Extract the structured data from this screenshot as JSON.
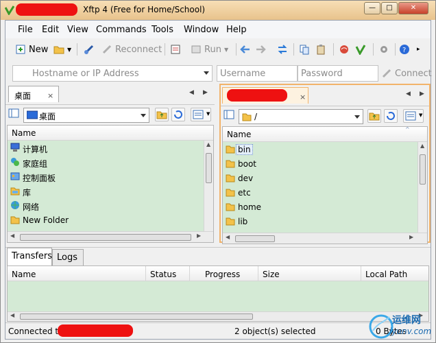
{
  "window": {
    "title": "Xftp 4 (Free for Home/School)",
    "controls": {
      "minimize": "—",
      "maximize": "□",
      "close": "✕"
    }
  },
  "menu": [
    "File",
    "Edit",
    "View",
    "Commands",
    "Tools",
    "Window",
    "Help"
  ],
  "toolbar": {
    "new_label": "New",
    "reconnect_label": "Reconnect",
    "run_label": "Run"
  },
  "connect_bar": {
    "host_placeholder": "Hostname or IP Address",
    "user_placeholder": "Username",
    "pass_placeholder": "Password",
    "connect_label": "Connect"
  },
  "local_panel": {
    "tab_label": "桌面",
    "path": "桌面",
    "column": "Name",
    "items": [
      {
        "label": "计算机",
        "icon": "computer-icon"
      },
      {
        "label": "家庭组",
        "icon": "homegroup-icon"
      },
      {
        "label": "控制面板",
        "icon": "control-panel-icon"
      },
      {
        "label": "库",
        "icon": "library-icon"
      },
      {
        "label": "网络",
        "icon": "network-icon"
      },
      {
        "label": "New Folder",
        "icon": "folder-icon"
      }
    ]
  },
  "remote_panel": {
    "tab_close": "×",
    "path": "/",
    "column": "Name",
    "items": [
      {
        "label": "bin",
        "icon": "folder-icon",
        "selected": true
      },
      {
        "label": "boot",
        "icon": "folder-icon"
      },
      {
        "label": "dev",
        "icon": "folder-icon"
      },
      {
        "label": "etc",
        "icon": "folder-icon"
      },
      {
        "label": "home",
        "icon": "folder-icon"
      },
      {
        "label": "lib",
        "icon": "folder-icon"
      }
    ]
  },
  "bottom_tabs": [
    "Transfers",
    "Logs"
  ],
  "transfer_columns": [
    "Name",
    "Status",
    "Progress",
    "Size",
    "Local Path"
  ],
  "status": {
    "connected_prefix": "Connected to",
    "selection": "2 object(s) selected",
    "bytes": "0 Bytes"
  },
  "watermark": {
    "text": "运维网",
    "subtext": "iyunv.com"
  },
  "colors": {
    "list_bg": "#d4ead5",
    "title_bar": "#f0d4a4",
    "active_tab_border": "#f2b36a",
    "redaction": "#ee1111"
  }
}
